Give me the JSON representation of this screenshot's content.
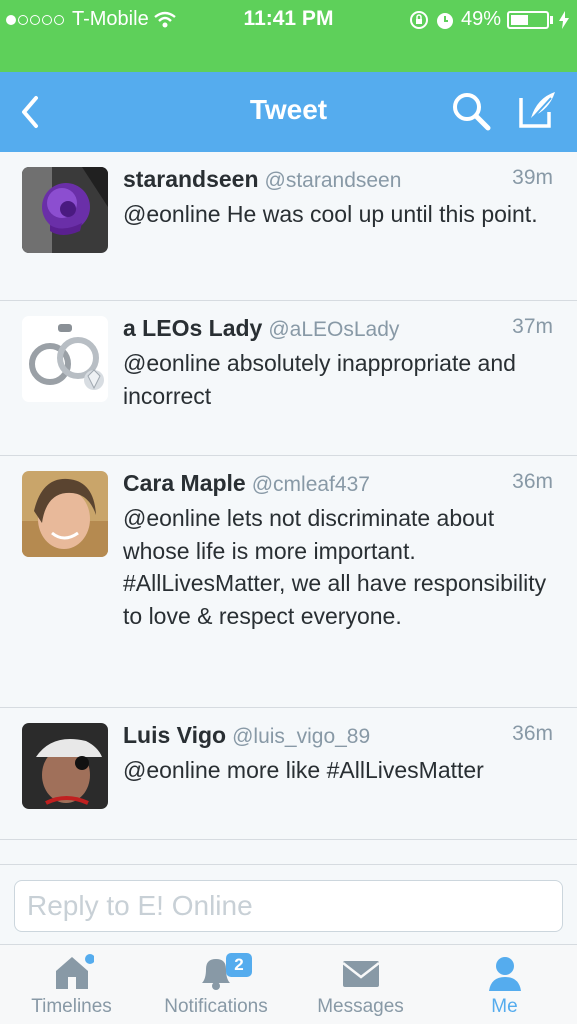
{
  "status_bar": {
    "carrier": "T-Mobile",
    "time": "11:41 PM",
    "battery": "49%",
    "battery_level": 0.49
  },
  "nav": {
    "title": "Tweet"
  },
  "tweets": [
    {
      "name": "starandseen",
      "handle": "@starandseen",
      "time": "39m",
      "text": "@eonline He was cool up until this point."
    },
    {
      "name": "a LEOs Lady",
      "handle": "@aLEOsLady",
      "time": "37m",
      "text": "@eonline absolutely inappropriate and incorrect"
    },
    {
      "name": "Cara Maple",
      "handle": "@cmleaf437",
      "time": "36m",
      "text": "@eonline lets not discriminate about whose life is more important. #AllLivesMatter, we all have responsibility to love & respect everyone."
    },
    {
      "name": "Luis Vigo",
      "handle": "@luis_vigo_89",
      "time": "36m",
      "text": "@eonline more like #AllLivesMatter"
    }
  ],
  "reply": {
    "placeholder": "Reply to E! Online"
  },
  "tabs": [
    {
      "label": "Timelines",
      "icon": "home-icon"
    },
    {
      "label": "Notifications",
      "icon": "bell-icon",
      "badge": "2"
    },
    {
      "label": "Messages",
      "icon": "envelope-icon"
    },
    {
      "label": "Me",
      "icon": "person-icon"
    }
  ],
  "colors": {
    "status_bar": "#5ed05a",
    "nav_bar": "#55acee",
    "accent": "#55acee"
  }
}
